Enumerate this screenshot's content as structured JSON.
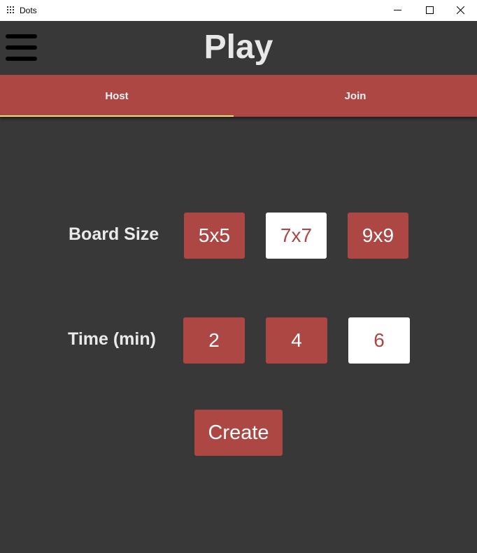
{
  "window": {
    "title": "Dots",
    "icon": "grid-dots-icon",
    "controls": [
      "minimize-icon",
      "maximize-icon",
      "close-icon"
    ]
  },
  "header": {
    "menu_icon": "hamburger-menu-icon",
    "title": "Play"
  },
  "tabs": [
    {
      "label": "Host",
      "selected": true
    },
    {
      "label": "Join",
      "selected": false
    }
  ],
  "board_size": {
    "label": "Board Size",
    "options": [
      "5x5",
      "7x7",
      "9x9"
    ],
    "selected": "7x7"
  },
  "time": {
    "label": "Time (min)",
    "options": [
      "2",
      "4",
      "6"
    ],
    "selected": "6"
  },
  "create_label": "Create",
  "colors": {
    "background": "#383838",
    "accent": "#ad4744",
    "tab_indicator": "#f0e27a",
    "selected_option_bg": "#ffffff"
  }
}
